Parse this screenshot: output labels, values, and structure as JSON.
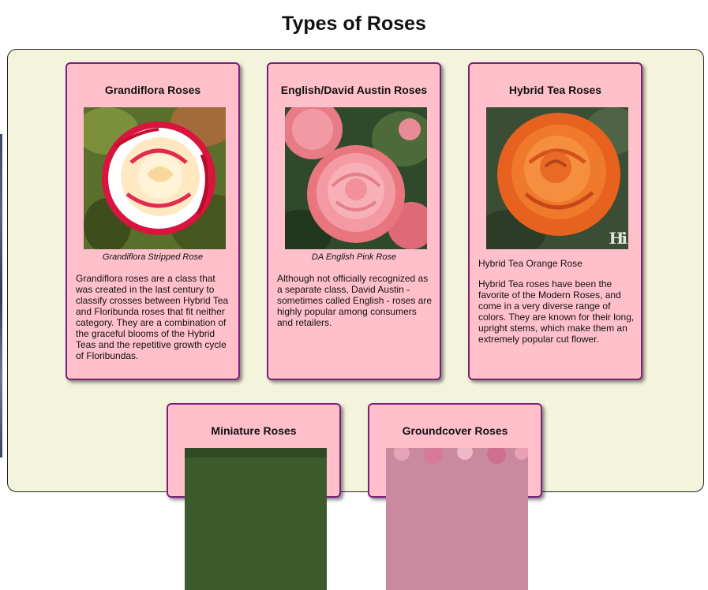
{
  "page": {
    "title": "Types of Roses"
  },
  "cards": [
    {
      "title": "Grandiflora Roses",
      "photo_icon": "white-red-edged-rose-photo",
      "caption": "Grandiflora Stripped Rose",
      "description": "Grandiflora roses are a class that was created in the last century to classify crosses between Hybrid Tea and Floribunda roses that fit neither category. They are a combination of the graceful blooms of the Hybrid Teas and the repetitive growth cycle of Floribundas."
    },
    {
      "title": "English/David Austin Roses",
      "photo_icon": "pink-english-rose-photo",
      "caption": "DA English Pink Rose",
      "description": "Although not officially recognized as a separate class, David Austin - sometimes called English - roses are highly popular among consumers and retailers."
    },
    {
      "title": "Hybrid Tea Roses",
      "photo_icon": "orange-hybrid-tea-rose-photo",
      "photo_watermark": "Hi",
      "caption": "Hybrid Tea Orange Rose",
      "description": "Hybrid Tea roses have been the favorite of the Modern Roses, and come in a very diverse range of colors. They are known for their long, upright stems, which make them an extremely popular cut flower."
    },
    {
      "title": "Miniature Roses",
      "photo_icon": "miniature-rose-photo"
    },
    {
      "title": "Groundcover Roses",
      "photo_icon": "groundcover-rose-photo"
    }
  ],
  "colors": {
    "panel_bg": "#f4f4dd",
    "card_bg": "#ffc0cb",
    "card_border": "#7a1f7a"
  }
}
